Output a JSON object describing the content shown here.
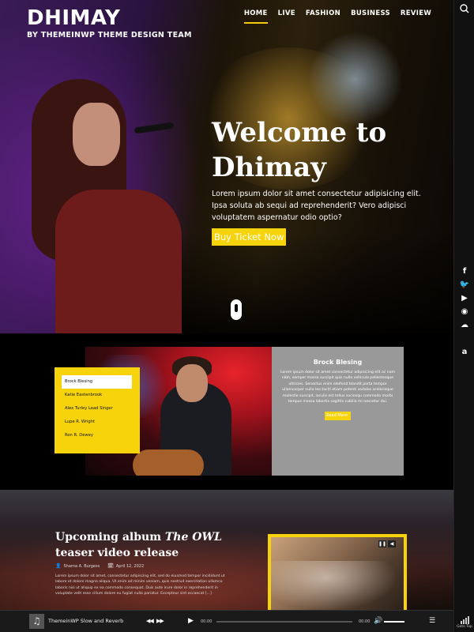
{
  "site": {
    "title": "DHIMAY",
    "tagline": "BY THEMEINWP THEME DESIGN TEAM"
  },
  "nav": {
    "items": [
      "HOME",
      "LIVE",
      "FASHION",
      "BUSINESS",
      "REVIEW"
    ],
    "active": "HOME"
  },
  "hero": {
    "heading": "Welcome to Dhimay",
    "text": "Lorem ipsum dolor sit amet consectetur adipisicing elit. Ipsa soluta ab sequi ad reprehenderit? Vero adipisci voluptatem aspernatur odio optio?",
    "button": "Buy Ticket Now"
  },
  "artists": {
    "list": [
      "Brock Blesing",
      "Katie Eastenbrook",
      "Alex Turley Lead Singer",
      "Lupe R. Wright",
      "Ron R. Dewey"
    ],
    "active_index": 0,
    "info": {
      "name": "Brock Blesing",
      "text": "Lorem ipsum dolor sit amet consectetur adipisicing elit ac nam nibh, semper massa suscipit quis nulla vehicula pellentesque ultricies. Senectus enim eleifend blandit porta tempor ullamcorper nulla leo taciti etiam potenti sodales scelerisque molestie suscipit, iaculis est tellus sociosqu commodo morbi tempus massa lobortis sagittis cubilia mi nascetur dui.",
      "button": "Read More"
    }
  },
  "album": {
    "title_prefix": "Upcoming album ",
    "title_em": "The OWL",
    "title_suffix": " teaser video release",
    "author": "Sharna A. Burgess",
    "date": "April 12, 2022",
    "excerpt": "Lorem ipsum dolor sit amet, consectetur adipiscing elit, sed do eiusmod tempor incididunt ut labore et dolore magna aliqua. Ut enim ad minim veniam, quis nostrud exercitation ullamco laboris nisi ut aliquip ex ea commodo consequat. Duis aute irure dolor in reprehenderit in voluptate velit esse cillum dolore eu fugiat nulla pariatur. Excepteur sint occaecat [...]"
  },
  "player": {
    "track": "ThemeinWP Slow and Reverb",
    "time_current": "00:00",
    "time_total": "00:00"
  },
  "rail": {
    "socials": [
      "facebook-icon",
      "twitter-icon",
      "youtube-icon",
      "spotify-icon",
      "soundcloud-icon",
      "apple-icon",
      "amazon-icon"
    ],
    "gotop": "Goto Top"
  },
  "colors": {
    "accent": "#f6d30a",
    "background": "#000000",
    "panel_gray": "#999999"
  }
}
